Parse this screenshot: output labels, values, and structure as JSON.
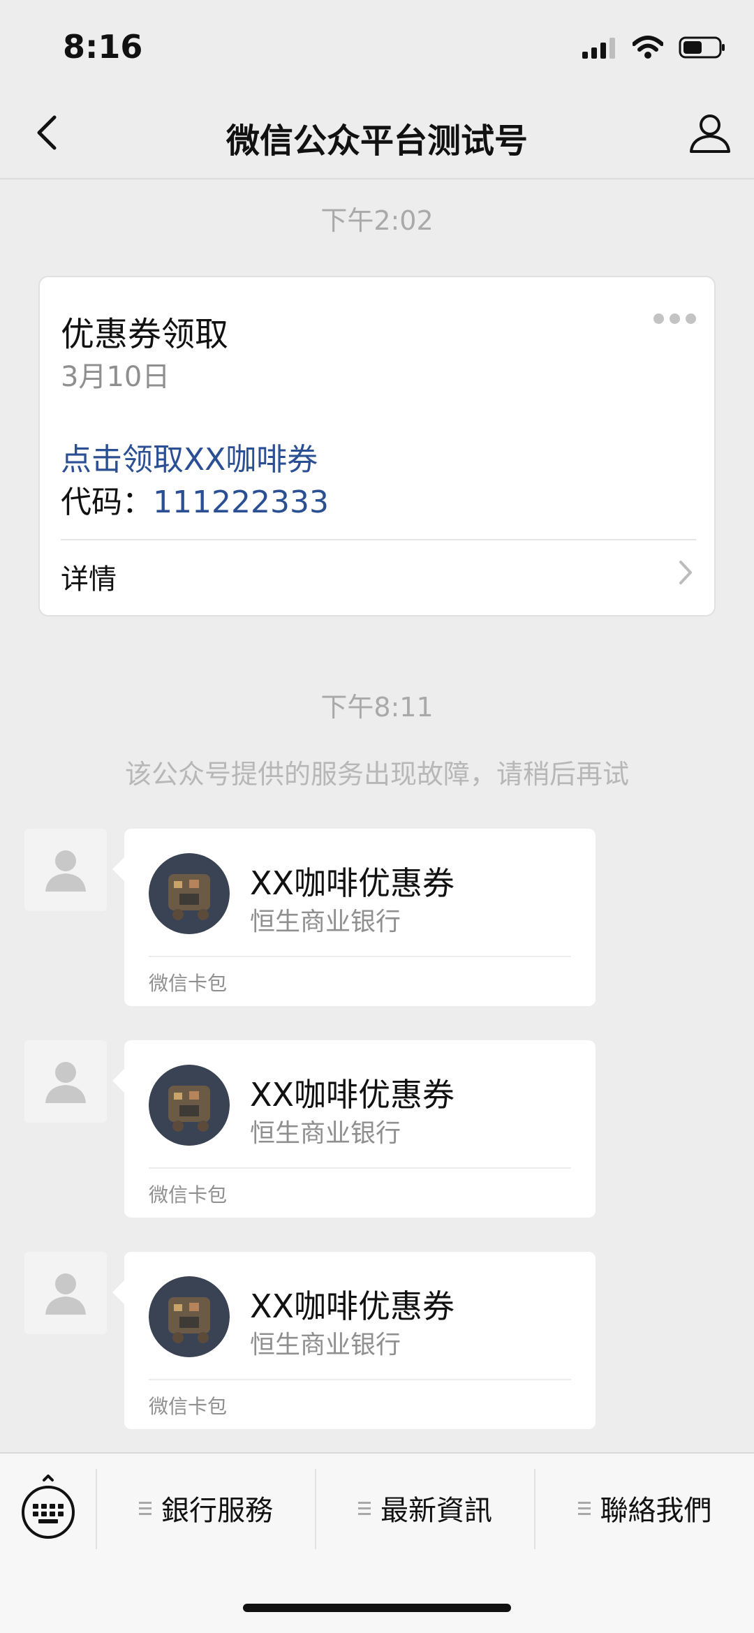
{
  "status_bar": {
    "time": "8:16"
  },
  "nav": {
    "title": "微信公众平台测试号"
  },
  "timestamps": [
    "下午2:02",
    "下午8:11"
  ],
  "template_message": {
    "title": "优惠券领取",
    "date": "3月10日",
    "link_text": "点击领取XX咖啡券",
    "code_label": "代码：",
    "code_value": "111222333",
    "detail_label": "详情"
  },
  "error_message": "该公众号提供的服务出现故障，请稍后再试",
  "coupons": [
    {
      "name": "XX咖啡优惠券",
      "issuer": "恒生商业银行",
      "source": "微信卡包"
    },
    {
      "name": "XX咖啡优惠券",
      "issuer": "恒生商业银行",
      "source": "微信卡包"
    },
    {
      "name": "XX咖啡优惠券",
      "issuer": "恒生商业银行",
      "source": "微信卡包"
    }
  ],
  "bottom_menu": {
    "items": [
      {
        "label": "銀行服務"
      },
      {
        "label": "最新資訊"
      },
      {
        "label": "聯絡我們"
      }
    ]
  },
  "colors": {
    "background": "#ededed",
    "link_blue": "#2b4f93",
    "secondary_text": "#8f8f8f",
    "card": "#ffffff"
  }
}
